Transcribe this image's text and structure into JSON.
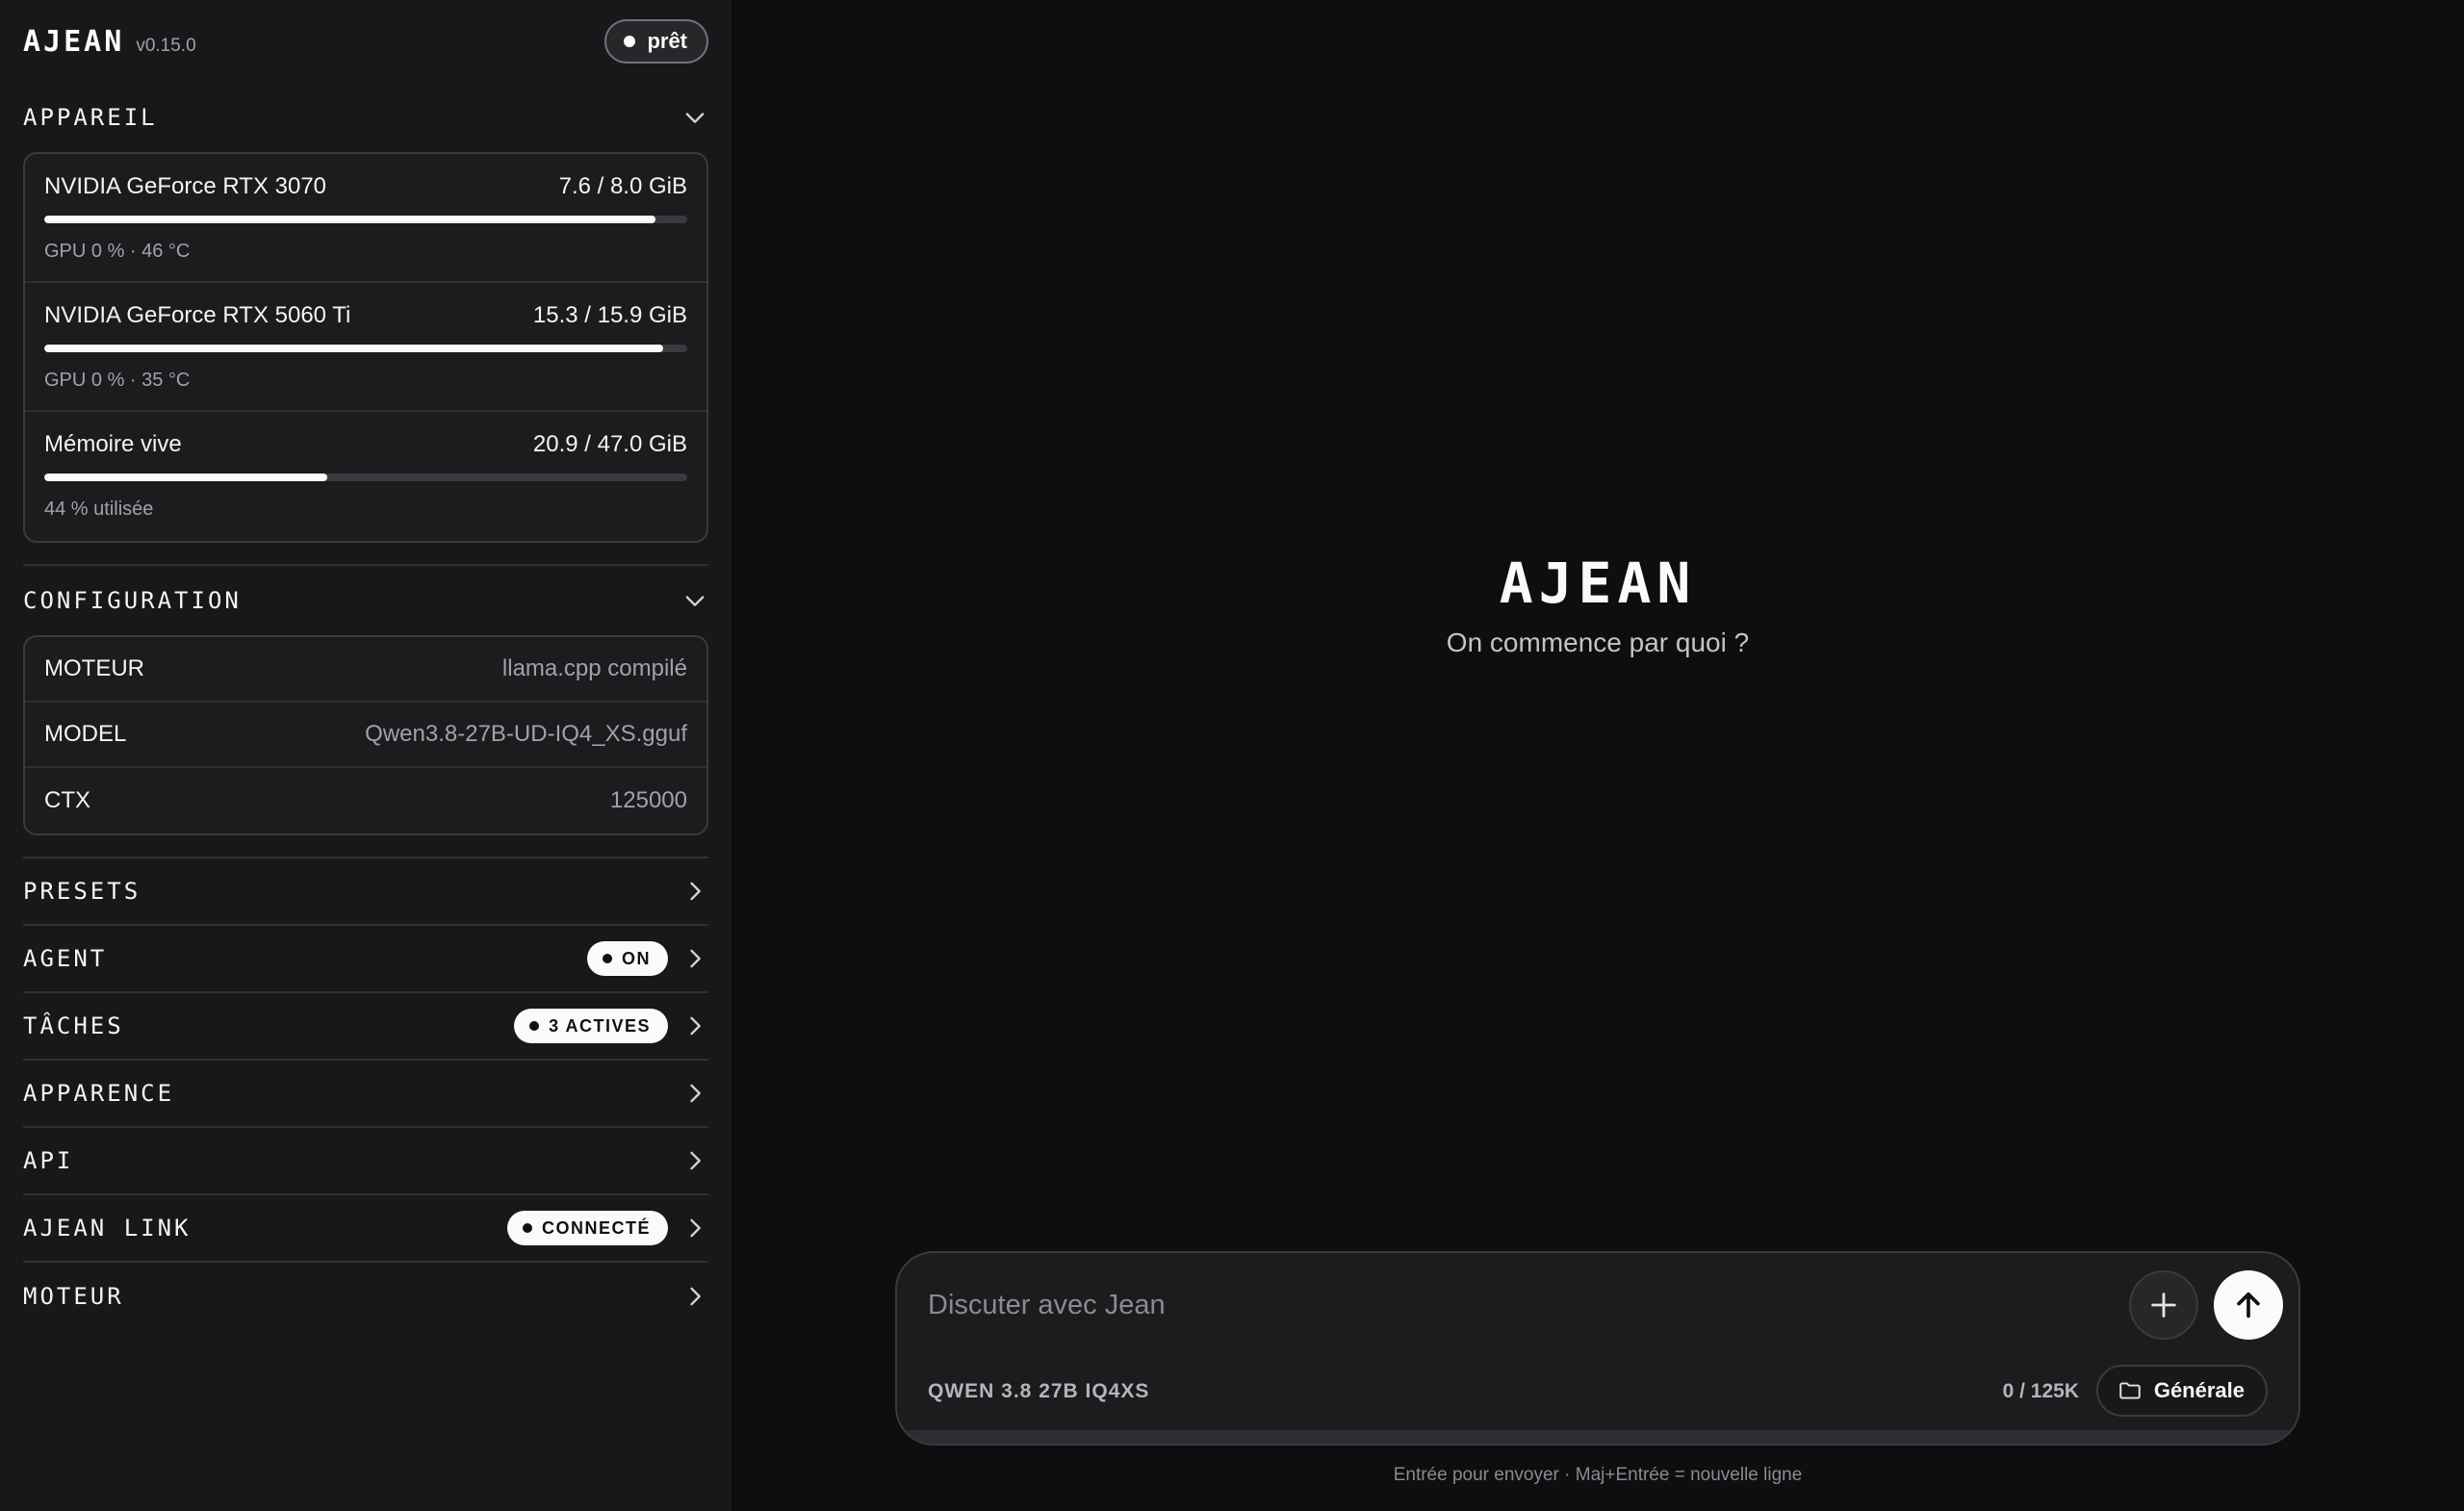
{
  "app": {
    "name": "AJEAN",
    "version": "v0.15.0",
    "status": "prêt"
  },
  "device": {
    "title": "APPAREIL",
    "items": [
      {
        "name": "NVIDIA GeForce RTX 3070",
        "usage": "7.6 / 8.0 GiB",
        "used_fraction": 0.95,
        "sub": "GPU 0 % · 46 °C"
      },
      {
        "name": "NVIDIA GeForce RTX 5060 Ti",
        "usage": "15.3 / 15.9 GiB",
        "used_fraction": 0.962,
        "sub": "GPU 0 % · 35 °C"
      },
      {
        "name": "Mémoire vive",
        "usage": "20.9 / 47.0 GiB",
        "used_fraction": 0.44,
        "sub": "44 % utilisée"
      }
    ]
  },
  "config": {
    "title": "CONFIGURATION",
    "rows": [
      {
        "key": "MOTEUR",
        "value": "llama.cpp compilé"
      },
      {
        "key": "MODEL",
        "value": "Qwen3.8-27B-UD-IQ4_XS.gguf"
      },
      {
        "key": "CTX",
        "value": "125000"
      }
    ]
  },
  "nav": [
    {
      "label": "PRESETS"
    },
    {
      "label": "AGENT",
      "badge": "ON"
    },
    {
      "label": "TÂCHES",
      "badge": "3 ACTIVES"
    },
    {
      "label": "APPARENCE"
    },
    {
      "label": "API"
    },
    {
      "label": "AJEAN LINK",
      "badge": "CONNECTÉ"
    },
    {
      "label": "MOTEUR"
    }
  ],
  "hero": {
    "logo": "AJEAN",
    "subtitle": "On commence par quoi ?"
  },
  "composer": {
    "placeholder": "Discuter avec Jean",
    "model": "QWEN 3.8 27B IQ4XS",
    "tokens": "0 / 125K",
    "folder": "Générale"
  },
  "hint": "Entrée pour envoyer · Maj+Entrée = nouvelle ligne",
  "icons": {
    "section_toggle": "chevron-down-icon",
    "nav_arrow": "chevron-right-icon",
    "add": "plus-icon",
    "send": "arrow-up-icon",
    "folder": "folder-icon"
  }
}
